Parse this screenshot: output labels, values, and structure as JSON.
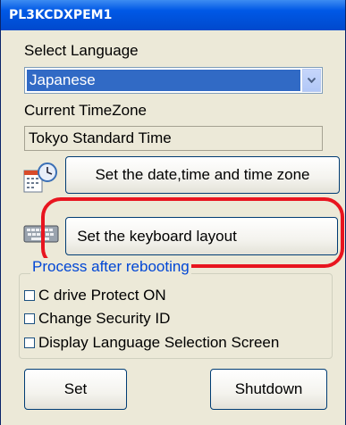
{
  "window": {
    "title": "PL3KCDXPEM1"
  },
  "language": {
    "label": "Select Language",
    "selected": "Japanese"
  },
  "timezone": {
    "label": "Current TimeZone",
    "value": "Tokyo Standard Time"
  },
  "buttons": {
    "set_datetime": "Set the date,time and time zone",
    "set_keyboard": "Set the keyboard layout",
    "set": "Set",
    "shutdown": "Shutdown"
  },
  "after_reboot": {
    "title": "Process after rebooting",
    "options": [
      {
        "label": "C drive Protect ON",
        "checked": false
      },
      {
        "label": "Change Security ID",
        "checked": false
      },
      {
        "label": "Display Language Selection Screen",
        "checked": false
      }
    ]
  },
  "icons": {
    "datetime": "calendar-clock-icon",
    "keyboard": "keyboard-icon",
    "dropdown": "chevron-down-icon"
  },
  "colors": {
    "titlebar": "#0058e6",
    "selection": "#316ac5",
    "highlight": "#e8151f",
    "group_title": "#0046d5"
  }
}
